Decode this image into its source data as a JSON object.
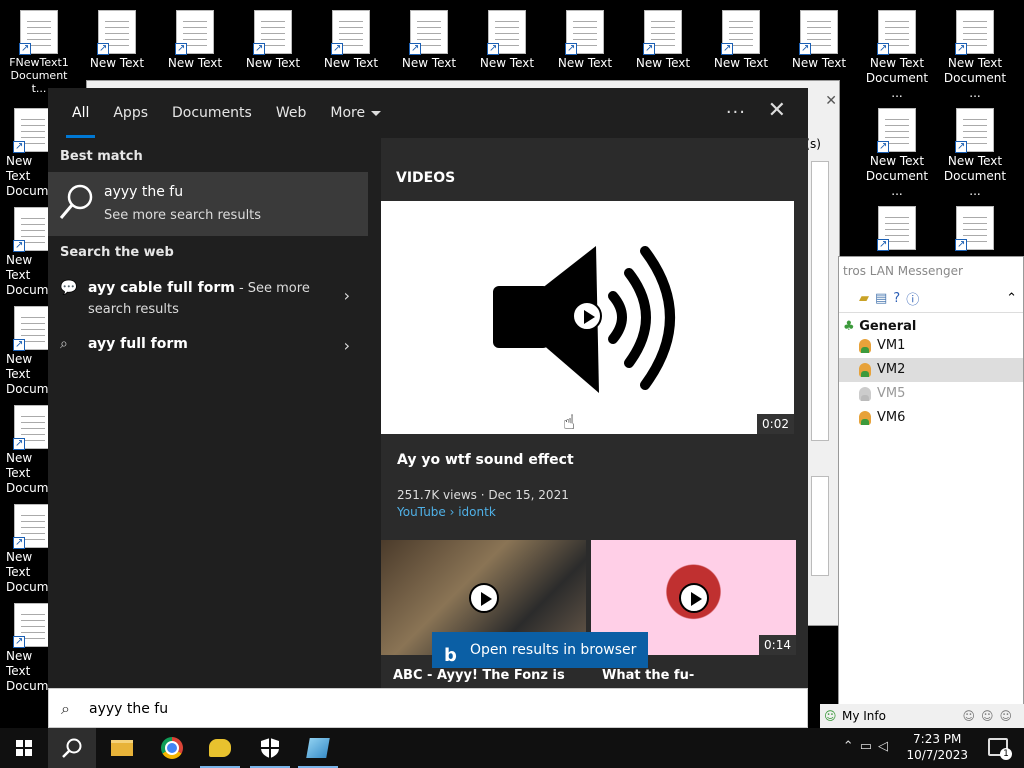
{
  "desktop": {
    "icons_top": [
      "New Text",
      "New Text",
      "New Text",
      "New Text",
      "New Text",
      "New Text",
      "New Text",
      "New Text",
      "New Text",
      "New Text",
      "New Text",
      "New Text"
    ],
    "icon_first_label": "FNewText1 Document t...",
    "icons_right": [
      "New Text Document ...",
      "New Text Document ...",
      "New Text Document ...",
      "New Text Document ..."
    ],
    "icons_left": [
      "New Text Docum",
      "New Text Docum",
      "New Text Docum",
      "New Text Docum",
      "New Text Docum",
      "New Text Docum"
    ]
  },
  "messenger": {
    "title": "tros LAN Messenger",
    "group": "General",
    "users": [
      "VM1",
      "VM2",
      "VM5",
      "VM6"
    ],
    "side_label": "le(s)",
    "my_info": "My Info"
  },
  "search": {
    "tabs": [
      "All",
      "Apps",
      "Documents",
      "Web",
      "More"
    ],
    "more_options": "···",
    "close": "✕",
    "best_match_heading": "Best match",
    "best_match_query": "ayyy the fu",
    "best_match_sub": "See more search results",
    "search_web_heading": "Search the web",
    "web_results": [
      {
        "bold": "ayy cable full form",
        "rest": " - See more",
        "line2": "search results"
      },
      {
        "bold": "ayy full form",
        "rest": "",
        "line2": ""
      }
    ],
    "videos_heading": "VIDEOS",
    "main_video": {
      "duration": "0:02",
      "title": "Ay yo wtf sound effect",
      "meta": "251.7K views · Dec 15, 2021",
      "source": "YouTube › idontk"
    },
    "more_videos": [
      {
        "caption": "ABC - Ayyy! The Fonz is",
        "duration": ""
      },
      {
        "caption": "What the fu-",
        "duration": "0:14"
      }
    ],
    "open_in_browser": "Open results in browser",
    "input_value": "ayyy the fu"
  },
  "taskbar": {
    "time": "7:23 PM",
    "date": "10/7/2023",
    "notifications": "1"
  }
}
